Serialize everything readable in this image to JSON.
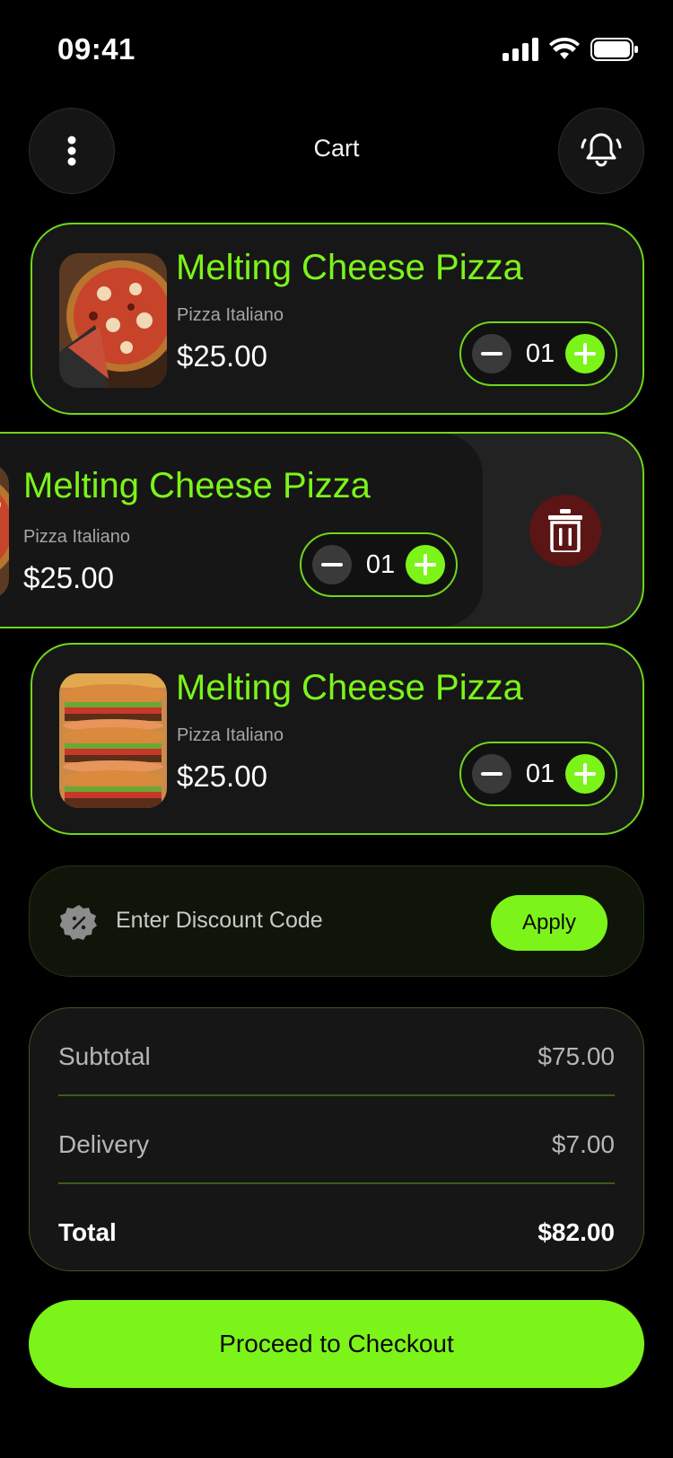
{
  "status_bar": {
    "time": "09:41"
  },
  "header": {
    "title": "Cart",
    "menu_icon": "more-vertical-icon",
    "bell_icon": "bell-icon"
  },
  "cart_items": [
    {
      "name": "Melting Cheese Pizza",
      "subtitle": "Pizza Italiano",
      "price": "$25.00",
      "quantity": "01",
      "image": "pizza"
    },
    {
      "name": "Melting Cheese Pizza",
      "subtitle": "Pizza Italiano",
      "price": "$25.00",
      "quantity": "01",
      "image": "pizza",
      "swiped": true
    },
    {
      "name": "Melting Cheese Pizza",
      "subtitle": "Pizza Italiano",
      "price": "$25.00",
      "quantity": "01",
      "image": "burger"
    }
  ],
  "discount": {
    "label": "Enter Discount Code",
    "button": "Apply"
  },
  "summary": {
    "subtotal_label": "Subtotal",
    "subtotal_value": "$75.00",
    "delivery_label": "Delivery",
    "delivery_value": "$7.00",
    "total_label": "Total",
    "total_value": "$82.00"
  },
  "checkout_button": "Proceed to Checkout",
  "colors": {
    "accent": "#7CF41A",
    "background": "#000000",
    "card": "#171717",
    "danger": "#5C1515"
  }
}
